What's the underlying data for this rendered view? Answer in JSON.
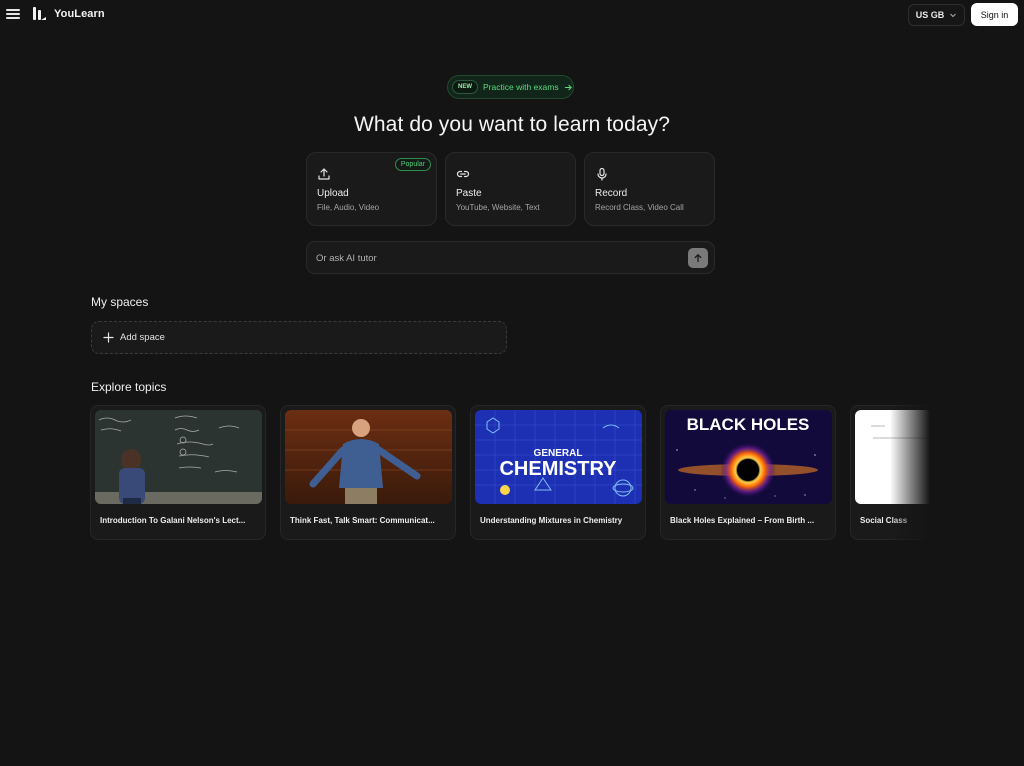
{
  "app": {
    "name": "YouLearn"
  },
  "header": {
    "language": "US GB",
    "signin_label": "Sign in"
  },
  "promo": {
    "badge": "NEW",
    "text": "Practice with exams"
  },
  "hero": {
    "title": "What do you want to learn today?"
  },
  "actions": [
    {
      "title": "Upload",
      "subtitle": "File, Audio, Video",
      "badge": "Popular",
      "icon": "upload-icon"
    },
    {
      "title": "Paste",
      "subtitle": "YouTube, Website, Text",
      "icon": "link-icon"
    },
    {
      "title": "Record",
      "subtitle": "Record Class, Video Call",
      "icon": "microphone-icon"
    }
  ],
  "ask": {
    "placeholder": "Or ask AI tutor"
  },
  "spaces": {
    "title": "My spaces",
    "add_label": "Add space"
  },
  "explore": {
    "title": "Explore topics",
    "topics": [
      {
        "title": "Introduction To Galani Nelson's Lect..."
      },
      {
        "title": "Think Fast, Talk Smart: Communicat..."
      },
      {
        "title": "Understanding Mixtures in Chemistry",
        "thumb_text": [
          "GENERAL",
          "CHEMISTRY"
        ]
      },
      {
        "title": "Black Holes Explained – From Birth ...",
        "thumb_text": [
          "BLACK HOLES"
        ]
      },
      {
        "title": "Social Class"
      }
    ]
  },
  "colors": {
    "accent_green": "#5bdc7b",
    "background": "#141414",
    "card": "#1a1a1a"
  }
}
